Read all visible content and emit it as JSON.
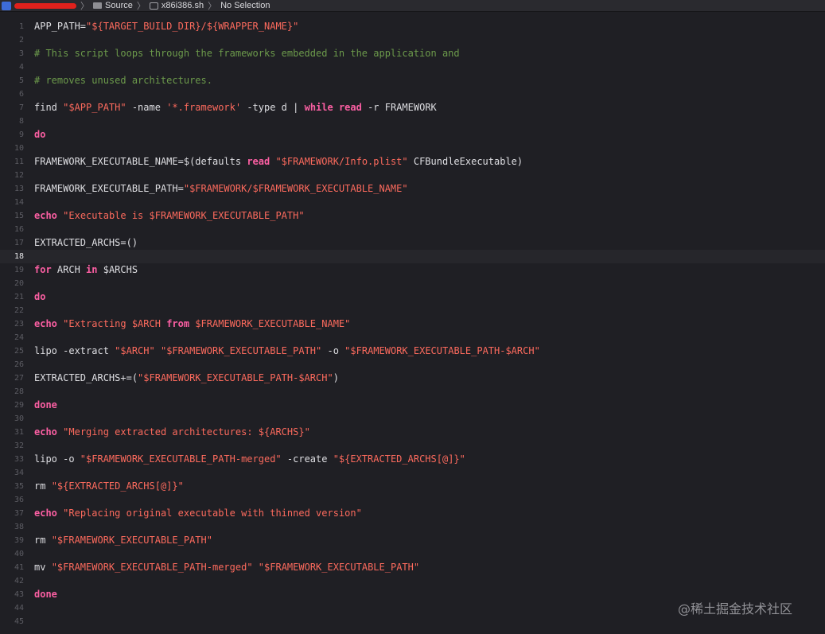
{
  "breadcrumb": {
    "items": [
      "Source",
      "x86i386.sh",
      "No Selection"
    ]
  },
  "editor": {
    "current_line": 18,
    "lines": [
      {
        "n": "1",
        "tokens": [
          {
            "t": "APP_PATH=",
            "c": "plain"
          },
          {
            "t": "\"${TARGET_BUILD_DIR}/${WRAPPER_NAME}\"",
            "c": "str"
          }
        ]
      },
      {
        "n": "2",
        "tokens": []
      },
      {
        "n": "3",
        "tokens": [
          {
            "t": "# This script loops through the frameworks embedded in the application and",
            "c": "cm"
          }
        ]
      },
      {
        "n": "4",
        "tokens": []
      },
      {
        "n": "5",
        "tokens": [
          {
            "t": "# removes unused architectures.",
            "c": "cm"
          }
        ]
      },
      {
        "n": "6",
        "tokens": []
      },
      {
        "n": "7",
        "tokens": [
          {
            "t": "find ",
            "c": "plain"
          },
          {
            "t": "\"$APP_PATH\"",
            "c": "str"
          },
          {
            "t": " -name ",
            "c": "plain"
          },
          {
            "t": "'*.framework'",
            "c": "str"
          },
          {
            "t": " -type d | ",
            "c": "plain"
          },
          {
            "t": "while",
            "c": "kw"
          },
          {
            "t": " ",
            "c": "plain"
          },
          {
            "t": "read",
            "c": "kw"
          },
          {
            "t": " -r FRAMEWORK",
            "c": "plain"
          }
        ]
      },
      {
        "n": "8",
        "tokens": []
      },
      {
        "n": "9",
        "tokens": [
          {
            "t": "do",
            "c": "kw"
          }
        ]
      },
      {
        "n": "10",
        "tokens": []
      },
      {
        "n": "11",
        "tokens": [
          {
            "t": "FRAMEWORK_EXECUTABLE_NAME=$(defaults ",
            "c": "plain"
          },
          {
            "t": "read",
            "c": "kw"
          },
          {
            "t": " ",
            "c": "plain"
          },
          {
            "t": "\"$FRAMEWORK/Info.plist\"",
            "c": "str"
          },
          {
            "t": " CFBundleExecutable)",
            "c": "plain"
          }
        ]
      },
      {
        "n": "12",
        "tokens": []
      },
      {
        "n": "13",
        "tokens": [
          {
            "t": "FRAMEWORK_EXECUTABLE_PATH=",
            "c": "plain"
          },
          {
            "t": "\"$FRAMEWORK/$FRAMEWORK_EXECUTABLE_NAME\"",
            "c": "str"
          }
        ]
      },
      {
        "n": "14",
        "tokens": []
      },
      {
        "n": "15",
        "tokens": [
          {
            "t": "echo",
            "c": "kw"
          },
          {
            "t": " ",
            "c": "plain"
          },
          {
            "t": "\"Executable is $FRAMEWORK_EXECUTABLE_PATH\"",
            "c": "str"
          }
        ]
      },
      {
        "n": "16",
        "tokens": []
      },
      {
        "n": "17",
        "tokens": [
          {
            "t": "EXTRACTED_ARCHS=()",
            "c": "plain"
          }
        ]
      },
      {
        "n": "18",
        "tokens": []
      },
      {
        "n": "19",
        "tokens": [
          {
            "t": "for",
            "c": "kw"
          },
          {
            "t": " ARCH ",
            "c": "plain"
          },
          {
            "t": "in",
            "c": "kw"
          },
          {
            "t": " $ARCHS",
            "c": "plain"
          }
        ]
      },
      {
        "n": "20",
        "tokens": []
      },
      {
        "n": "21",
        "tokens": [
          {
            "t": "do",
            "c": "kw"
          }
        ]
      },
      {
        "n": "22",
        "tokens": []
      },
      {
        "n": "23",
        "tokens": [
          {
            "t": "echo",
            "c": "kw"
          },
          {
            "t": " ",
            "c": "plain"
          },
          {
            "t": "\"Extracting $ARCH ",
            "c": "str"
          },
          {
            "t": "from",
            "c": "kw"
          },
          {
            "t": " $FRAMEWORK_EXECUTABLE_NAME\"",
            "c": "str"
          }
        ]
      },
      {
        "n": "24",
        "tokens": []
      },
      {
        "n": "25",
        "tokens": [
          {
            "t": "lipo -extract ",
            "c": "plain"
          },
          {
            "t": "\"$ARCH\"",
            "c": "str"
          },
          {
            "t": " ",
            "c": "plain"
          },
          {
            "t": "\"$FRAMEWORK_EXECUTABLE_PATH\"",
            "c": "str"
          },
          {
            "t": " -o ",
            "c": "plain"
          },
          {
            "t": "\"$FRAMEWORK_EXECUTABLE_PATH-$ARCH\"",
            "c": "str"
          }
        ]
      },
      {
        "n": "26",
        "tokens": []
      },
      {
        "n": "27",
        "tokens": [
          {
            "t": "EXTRACTED_ARCHS+=(",
            "c": "plain"
          },
          {
            "t": "\"$FRAMEWORK_EXECUTABLE_PATH-$ARCH\"",
            "c": "str"
          },
          {
            "t": ")",
            "c": "plain"
          }
        ]
      },
      {
        "n": "28",
        "tokens": []
      },
      {
        "n": "29",
        "tokens": [
          {
            "t": "done",
            "c": "kw"
          }
        ]
      },
      {
        "n": "30",
        "tokens": []
      },
      {
        "n": "31",
        "tokens": [
          {
            "t": "echo",
            "c": "kw"
          },
          {
            "t": " ",
            "c": "plain"
          },
          {
            "t": "\"Merging extracted architectures: ${ARCHS}\"",
            "c": "str"
          }
        ]
      },
      {
        "n": "32",
        "tokens": []
      },
      {
        "n": "33",
        "tokens": [
          {
            "t": "lipo -o ",
            "c": "plain"
          },
          {
            "t": "\"$FRAMEWORK_EXECUTABLE_PATH-merged\"",
            "c": "str"
          },
          {
            "t": " -create ",
            "c": "plain"
          },
          {
            "t": "\"${EXTRACTED_ARCHS[@]}\"",
            "c": "str"
          }
        ]
      },
      {
        "n": "34",
        "tokens": []
      },
      {
        "n": "35",
        "tokens": [
          {
            "t": "rm ",
            "c": "plain"
          },
          {
            "t": "\"${EXTRACTED_ARCHS[@]}\"",
            "c": "str"
          }
        ]
      },
      {
        "n": "36",
        "tokens": []
      },
      {
        "n": "37",
        "tokens": [
          {
            "t": "echo",
            "c": "kw"
          },
          {
            "t": " ",
            "c": "plain"
          },
          {
            "t": "\"Replacing original executable with thinned version\"",
            "c": "str"
          }
        ]
      },
      {
        "n": "38",
        "tokens": []
      },
      {
        "n": "39",
        "tokens": [
          {
            "t": "rm ",
            "c": "plain"
          },
          {
            "t": "\"$FRAMEWORK_EXECUTABLE_PATH\"",
            "c": "str"
          }
        ]
      },
      {
        "n": "40",
        "tokens": []
      },
      {
        "n": "41",
        "tokens": [
          {
            "t": "mv ",
            "c": "plain"
          },
          {
            "t": "\"$FRAMEWORK_EXECUTABLE_PATH-merged\"",
            "c": "str"
          },
          {
            "t": " ",
            "c": "plain"
          },
          {
            "t": "\"$FRAMEWORK_EXECUTABLE_PATH\"",
            "c": "str"
          }
        ]
      },
      {
        "n": "42",
        "tokens": []
      },
      {
        "n": "43",
        "tokens": [
          {
            "t": "done",
            "c": "kw"
          }
        ]
      },
      {
        "n": "44",
        "tokens": []
      },
      {
        "n": "45",
        "tokens": []
      }
    ]
  },
  "watermark": "@稀土掘金技术社区",
  "colors": {
    "background": "#1f1f24",
    "keyword": "#fc5fa3",
    "string": "#fc6a5d",
    "comment": "#6c9a4b",
    "plain": "#dfdfe3",
    "line_number": "#5c5c63"
  }
}
